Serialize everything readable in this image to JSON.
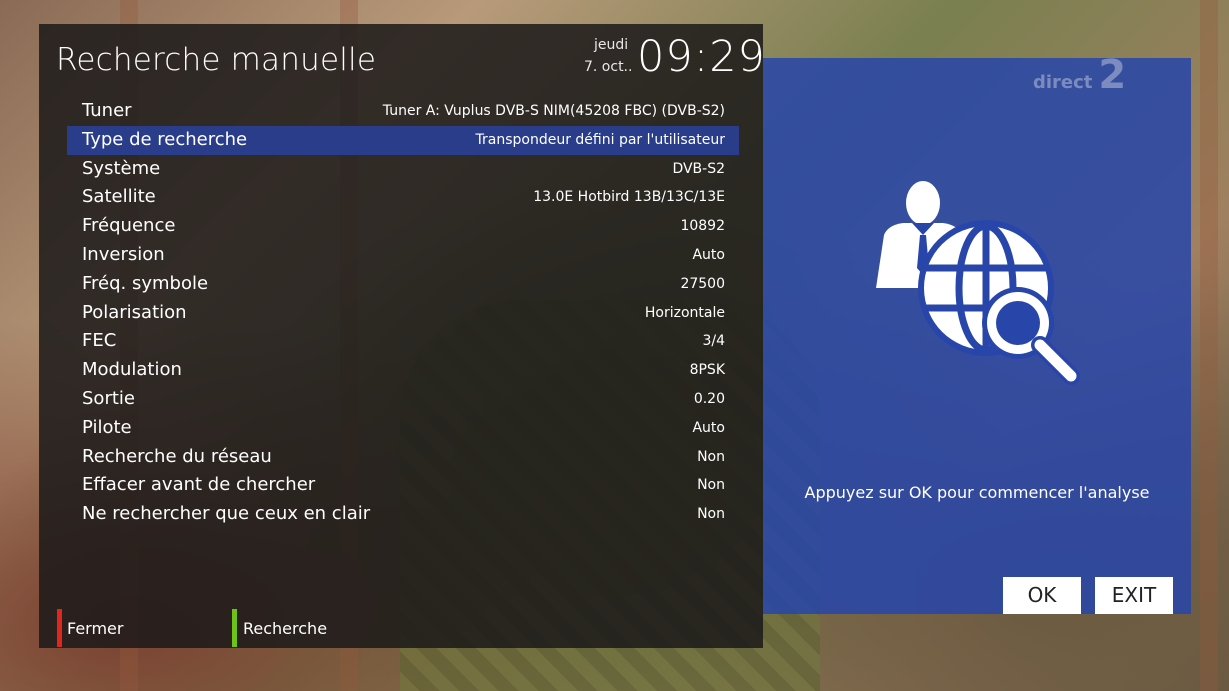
{
  "header": {
    "title": "Recherche manuelle",
    "day": "jeudi",
    "date": "7. oct..",
    "time": "09:29"
  },
  "settings": [
    {
      "label": "Tuner",
      "value": "Tuner A: Vuplus DVB-S NIM(45208 FBC) (DVB-S2)"
    },
    {
      "label": "Type de recherche",
      "value": "Transpondeur défini par l'utilisateur",
      "selected": true
    },
    {
      "label": "Système",
      "value": "DVB-S2"
    },
    {
      "label": "Satellite",
      "value": "13.0E Hotbird 13B/13C/13E"
    },
    {
      "label": "Fréquence",
      "value": "10892"
    },
    {
      "label": "Inversion",
      "value": "Auto"
    },
    {
      "label": "Fréq. symbole",
      "value": "27500"
    },
    {
      "label": "Polarisation",
      "value": "Horizontale"
    },
    {
      "label": "FEC",
      "value": "3/4"
    },
    {
      "label": "Modulation",
      "value": "8PSK"
    },
    {
      "label": "Sortie",
      "value": "0.20"
    },
    {
      "label": "Pilote",
      "value": "Auto"
    },
    {
      "label": "Recherche du réseau",
      "value": "Non"
    },
    {
      "label": "Effacer avant de chercher",
      "value": "Non"
    },
    {
      "label": "Ne rechercher que ceux en clair",
      "value": "Non"
    }
  ],
  "color_keys": {
    "red": {
      "label": "Fermer",
      "color": "#e0261e"
    },
    "green": {
      "label": "Recherche",
      "color": "#6ec21a"
    }
  },
  "info_panel": {
    "channel_logo_text": "direct",
    "channel_logo_number": "2",
    "icon": "user-globe-search-icon",
    "hint": "Appuyez sur OK pour commencer l'analyse",
    "ok_label": "OK",
    "exit_label": "EXIT"
  },
  "colors": {
    "selection": "#2a3d8a",
    "info_panel_bg": "#2846aa",
    "menu_bg": "#1c1a1a"
  }
}
